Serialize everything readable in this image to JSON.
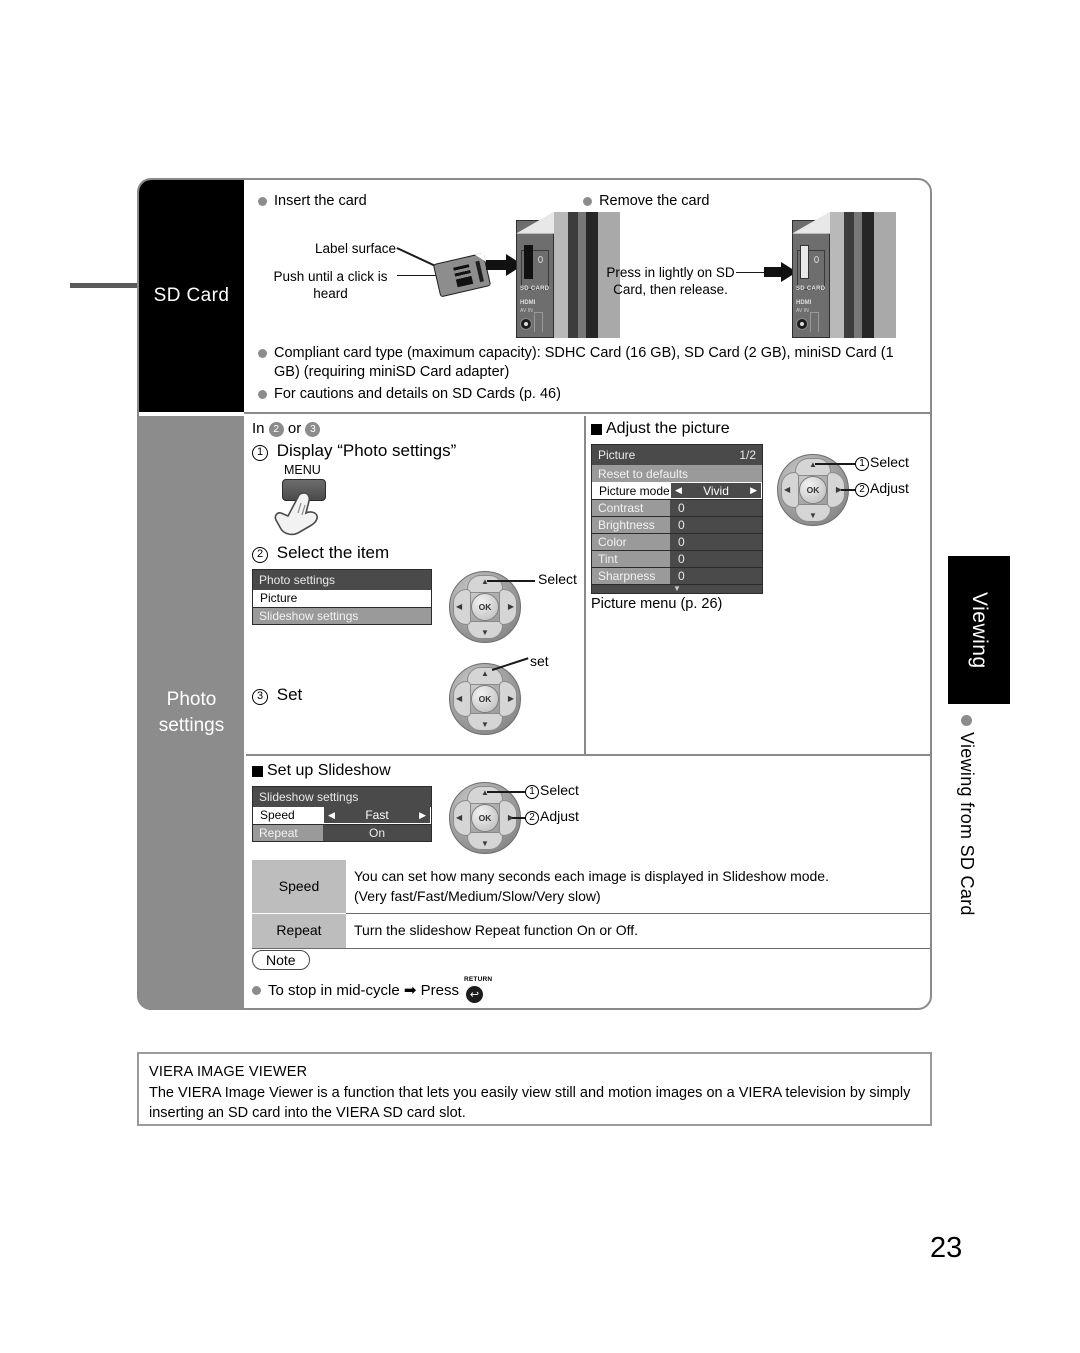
{
  "sd_section": {
    "tab_label": "SD Card",
    "insert_heading": "Insert the card",
    "remove_heading": "Remove the card",
    "label_surface": "Label surface",
    "push_until_click": "Push until a click is\nheard",
    "press_release": "Press in lightly on SD\nCard, then release.",
    "device_labels": {
      "sd_card": "SD CARD",
      "hdmi": "HDMI",
      "av_in": "AV IN"
    },
    "bullets": [
      "Compliant card type (maximum capacity): SDHC Card (16 GB), SD Card (2 GB), miniSD Card (1 GB) (requiring miniSD Card adapter)",
      "For cautions and details on SD Cards (p. 46)"
    ]
  },
  "photo_section": {
    "tab_label": "Photo\nsettings",
    "in_line_prefix": "In",
    "in_num_1": "2",
    "in_or": "or",
    "in_num_2": "3",
    "step1_num": "1",
    "step1_label": "Display “Photo settings”",
    "menu_key_label": "MENU",
    "step2_num": "2",
    "step2_label": "Select the item",
    "step3_num": "3",
    "step3_label": "Set",
    "select_label": "Select",
    "set_label": "set",
    "photo_settings_menu": {
      "title": "Photo settings",
      "rows": [
        {
          "name": "Picture",
          "style": "selected"
        },
        {
          "name": "Slideshow settings",
          "style": "gray"
        }
      ]
    }
  },
  "adjust_picture": {
    "heading": "Adjust the picture",
    "menu": {
      "title": "Picture",
      "page": "1/2",
      "rows": [
        {
          "name": "Reset to defaults",
          "value": "",
          "style": "gray-full"
        },
        {
          "name": "Picture mode",
          "value": "Vivid",
          "style": "selected-arrows"
        },
        {
          "name": "Contrast",
          "value": "0",
          "style": "gray"
        },
        {
          "name": "Brightness",
          "value": "0",
          "style": "gray"
        },
        {
          "name": "Color",
          "value": "0",
          "style": "gray"
        },
        {
          "name": "Tint",
          "value": "0",
          "style": "gray"
        },
        {
          "name": "Sharpness",
          "value": "0",
          "style": "gray"
        }
      ]
    },
    "caption": "Picture menu (p. 26)",
    "callout_1_num": "1",
    "callout_1": "Select",
    "callout_2_num": "2",
    "callout_2": "Adjust"
  },
  "slideshow": {
    "heading": "Set up Slideshow",
    "menu": {
      "title": "Slideshow settings",
      "rows": [
        {
          "name": "Speed",
          "value": "Fast",
          "style": "selected-arrows"
        },
        {
          "name": "Repeat",
          "value": "On",
          "style": "gray"
        }
      ]
    },
    "callout_1_num": "1",
    "callout_1": "Select",
    "callout_2_num": "2",
    "callout_2": "Adjust",
    "table": [
      {
        "key": "Speed",
        "desc": "You can set how many seconds each image is displayed in Slideshow mode.\n(Very fast/Fast/Medium/Slow/Very slow)"
      },
      {
        "key": "Repeat",
        "desc": "Turn the slideshow Repeat function On or Off."
      }
    ],
    "note_label": "Note",
    "note_text": "To stop in mid-cycle ➡ Press",
    "return_key_label": "RETURN",
    "return_glyph": "↩"
  },
  "right_tab": {
    "label": "Viewing",
    "sub_label": "Viewing from SD Card"
  },
  "viewer_box": {
    "title": "VIERA IMAGE VIEWER",
    "body": "The VIERA Image Viewer is a function that lets you easily view still and motion images on a VIERA television by simply inserting an SD card into the VIERA SD card slot."
  },
  "page_number": "23",
  "colors": {
    "tab_black": "#000000",
    "tab_gray": "#8c8c8c",
    "osd_dark": "#4a4a4a",
    "osd_gray": "#9a9a9a",
    "border": "#8a8a8a"
  }
}
